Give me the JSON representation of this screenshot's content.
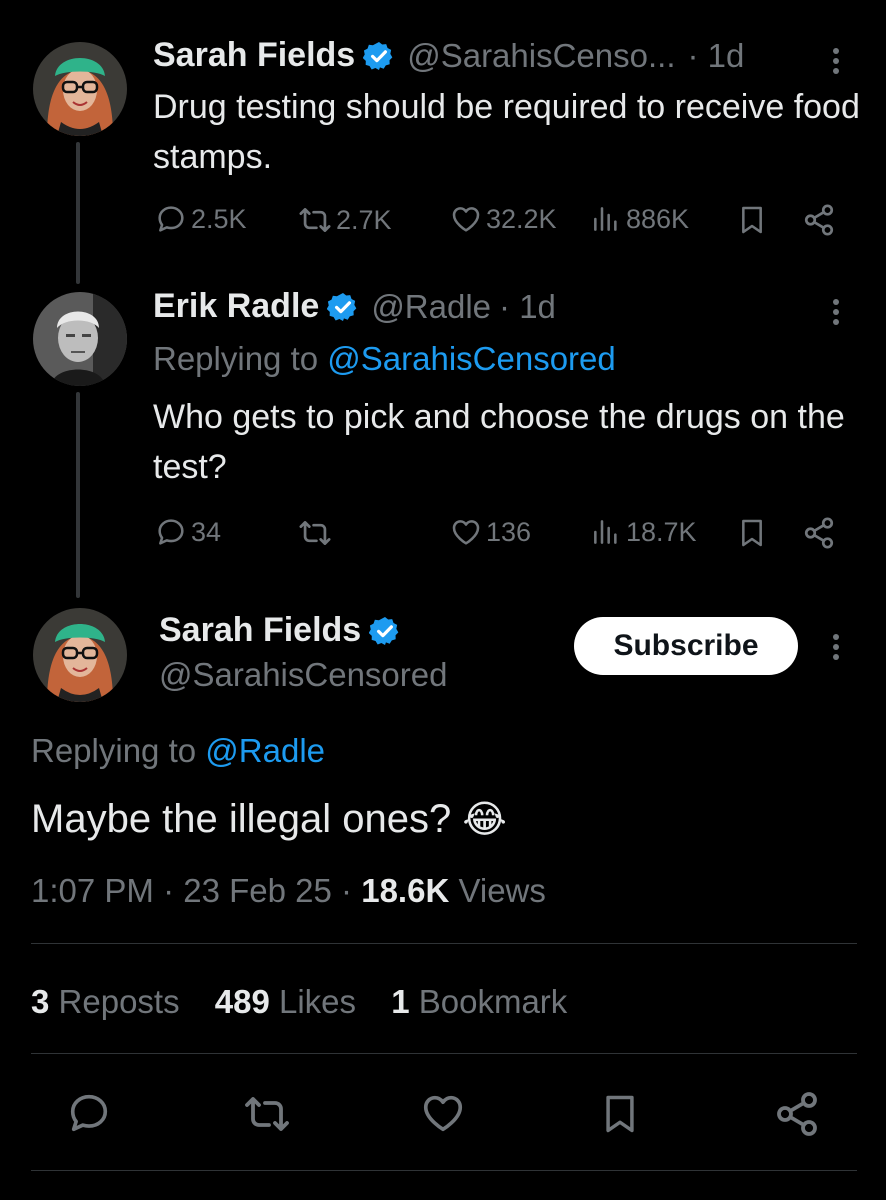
{
  "tweet1": {
    "author_name": "Sarah Fields",
    "handle": "@SarahisCenso...",
    "time": "· 1d",
    "text": "Drug testing should be required to receive food stamps.",
    "replies": "2.5K",
    "reposts": "2.7K",
    "likes": "32.2K",
    "views": "886K"
  },
  "tweet2": {
    "author_name": "Erik Radle",
    "handle": "@Radle",
    "time": "· 1d",
    "replying_prefix": "Replying to",
    "replying_to": "@SarahisCensored",
    "text": "Who gets to pick and choose the drugs on the test?",
    "replies": "34",
    "reposts": "",
    "likes": "136",
    "views": "18.7K"
  },
  "main_tweet": {
    "author_name": "Sarah Fields",
    "handle": "@SarahisCensored",
    "subscribe_label": "Subscribe",
    "replying_prefix": "Replying to",
    "replying_to": "@Radle",
    "text": "Maybe the illegal ones?",
    "emoji": "😂",
    "time": "1:07 PM",
    "date": "23 Feb 25",
    "views_count": "18.6K",
    "views_label": "Views",
    "reposts_count": "3",
    "reposts_label": "Reposts",
    "likes_count": "489",
    "likes_label": "Likes",
    "bookmarks_count": "1",
    "bookmarks_label": "Bookmark"
  },
  "colors": {
    "background": "#000000",
    "text": "#e7e9ea",
    "muted": "#71767b",
    "link": "#1d9bf0",
    "verified": "#1d9bf0"
  }
}
